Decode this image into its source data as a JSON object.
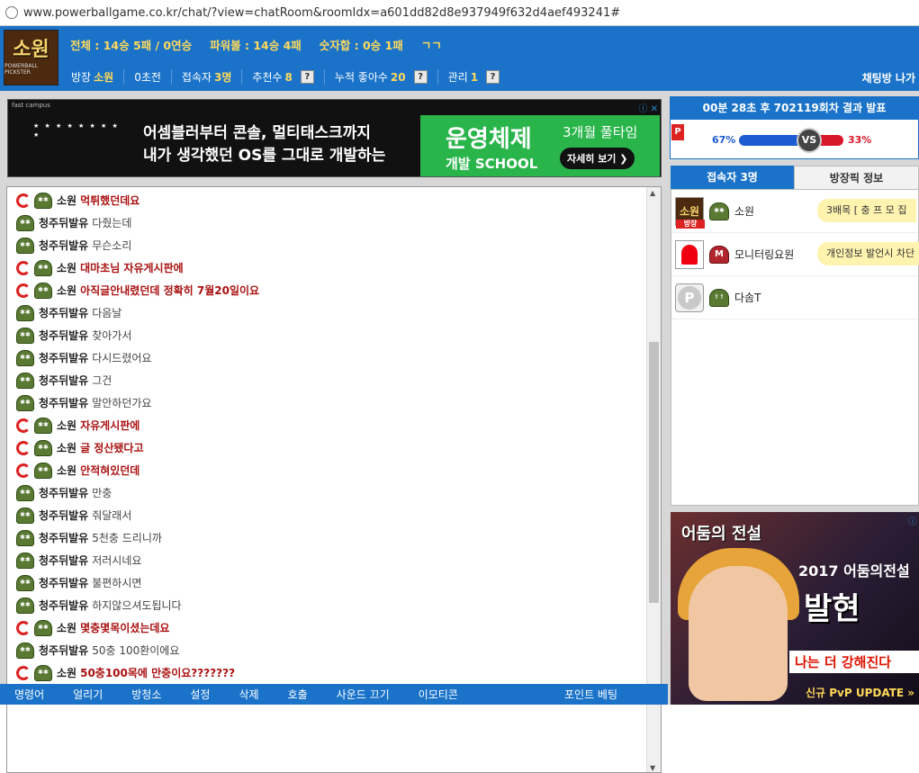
{
  "browser": {
    "url": "www.powerballgame.co.kr/chat/?view=chatRoom&roomIdx=a601dd82d8e937949f632d4aef493241#"
  },
  "header": {
    "logo_text": "소원",
    "logo_sub": "POWERBALL PICKSTER",
    "stats": {
      "total": "전체 : 14승 5패 / 0연승",
      "powerball": "파워볼 : 14승 4패",
      "numsum": "숫자합 : 0승 1패",
      "extra": "ㄱㄱ"
    },
    "nav": {
      "owner_label": "방장",
      "owner_name": "소원",
      "init": "0초전",
      "users_label": "접속자",
      "users_value": "3명",
      "recommend_label": "추천수",
      "recommend_value": "8",
      "cum_label": "누적 좋아수",
      "cum_value": "20",
      "admin_label": "관리",
      "admin_value": "1",
      "help": "?",
      "exit": "채팅방 나가"
    }
  },
  "ad_top": {
    "brand": "fast campus",
    "icons": "ⓘ ✕",
    "dots": "★ ★ ★ ★ ★ ★ ★ ★ ★",
    "line1": "어셈블러부터 콘솔, 멀티태스크까지",
    "line2": "내가 생각했던 OS를 그대로 개발하는",
    "green_title": "운영체제",
    "green_sub": "개발 SCHOOL",
    "green_right": "3개월 풀타임",
    "cta": "자세히 보기 ❯"
  },
  "chat": {
    "messages": [
      {
        "rank": true,
        "nick": "소원",
        "text": "먹튀했던데요",
        "hl": true
      },
      {
        "rank": false,
        "nick": "청주뒤발유",
        "text": "다줬는데",
        "hl": false
      },
      {
        "rank": false,
        "nick": "청주뒤발유",
        "text": "무슨소리",
        "hl": false
      },
      {
        "rank": true,
        "nick": "소원",
        "text": "대마초님 자유게시판에",
        "hl": true
      },
      {
        "rank": true,
        "nick": "소원",
        "text": "아직글안내렸던데 정확히 7월20일이요",
        "hl": true
      },
      {
        "rank": false,
        "nick": "청주뒤발유",
        "text": "다음날",
        "hl": false
      },
      {
        "rank": false,
        "nick": "청주뒤발유",
        "text": "찾아가서",
        "hl": false
      },
      {
        "rank": false,
        "nick": "청주뒤발유",
        "text": "다시드렸어요",
        "hl": false
      },
      {
        "rank": false,
        "nick": "청주뒤발유",
        "text": "그건",
        "hl": false
      },
      {
        "rank": false,
        "nick": "청주뒤발유",
        "text": "말안하던가요",
        "hl": false
      },
      {
        "rank": true,
        "nick": "소원",
        "text": "자유게시판에",
        "hl": true
      },
      {
        "rank": true,
        "nick": "소원",
        "text": "글 정산됐다고",
        "hl": true
      },
      {
        "rank": true,
        "nick": "소원",
        "text": "안적혀있던데",
        "hl": true
      },
      {
        "rank": false,
        "nick": "청주뒤발유",
        "text": "만충",
        "hl": false
      },
      {
        "rank": false,
        "nick": "청주뒤발유",
        "text": "줘달래서",
        "hl": false
      },
      {
        "rank": false,
        "nick": "청주뒤발유",
        "text": "5천충 드리니까",
        "hl": false
      },
      {
        "rank": false,
        "nick": "청주뒤발유",
        "text": "저러시네요",
        "hl": false
      },
      {
        "rank": false,
        "nick": "청주뒤발유",
        "text": "불편하시면",
        "hl": false
      },
      {
        "rank": false,
        "nick": "청주뒤발유",
        "text": "하지않으셔도됩니다",
        "hl": false
      },
      {
        "rank": true,
        "nick": "소원",
        "text": "몇충몇목이셨는데요",
        "hl": true
      },
      {
        "rank": false,
        "nick": "청주뒤발유",
        "text": "50충 100환이에요",
        "hl": false
      },
      {
        "rank": true,
        "nick": "소원",
        "text": "50충100목에 만충이요???????",
        "hl": true
      }
    ]
  },
  "bottom": {
    "b1": "명령어",
    "b2": "얼리기",
    "b3": "방청소",
    "b4": "설정",
    "b5": "삭제",
    "b6": "호출",
    "b7": "사운드 끄기",
    "b8": "이모티콘",
    "b9": "포인트 베팅"
  },
  "result": {
    "title": "00분 28초 후 702119회차 결과 발표",
    "p_badge": "P",
    "left_pct": "67%",
    "right_pct": "33%",
    "left_value": 67,
    "right_value": 33,
    "vs": "VS"
  },
  "tabs": {
    "users": "접속자 3명",
    "info": "방장픽 정보"
  },
  "users": [
    {
      "name": "소원",
      "pic": "소원",
      "badge": "방장",
      "bubble": "3배목 [ 충 프 모 집"
    },
    {
      "name": "모니터링요원",
      "pic": "",
      "badge": "",
      "bubble": "개인정보 발언시 차단"
    },
    {
      "name": "다솜T",
      "pic": "",
      "badge": "",
      "bubble": ""
    }
  ],
  "ad_right": {
    "title": "어둠의 전설",
    "year": "2017 어둠의전설",
    "big": "발현",
    "slogan": "나는 더 강해진다",
    "update": "신규 PvP UPDATE »",
    "icon": "ⓘ"
  },
  "colors": {
    "header_blue": "#1a73c9",
    "highlight_red": "#a11",
    "gold": "#ffd95a"
  }
}
